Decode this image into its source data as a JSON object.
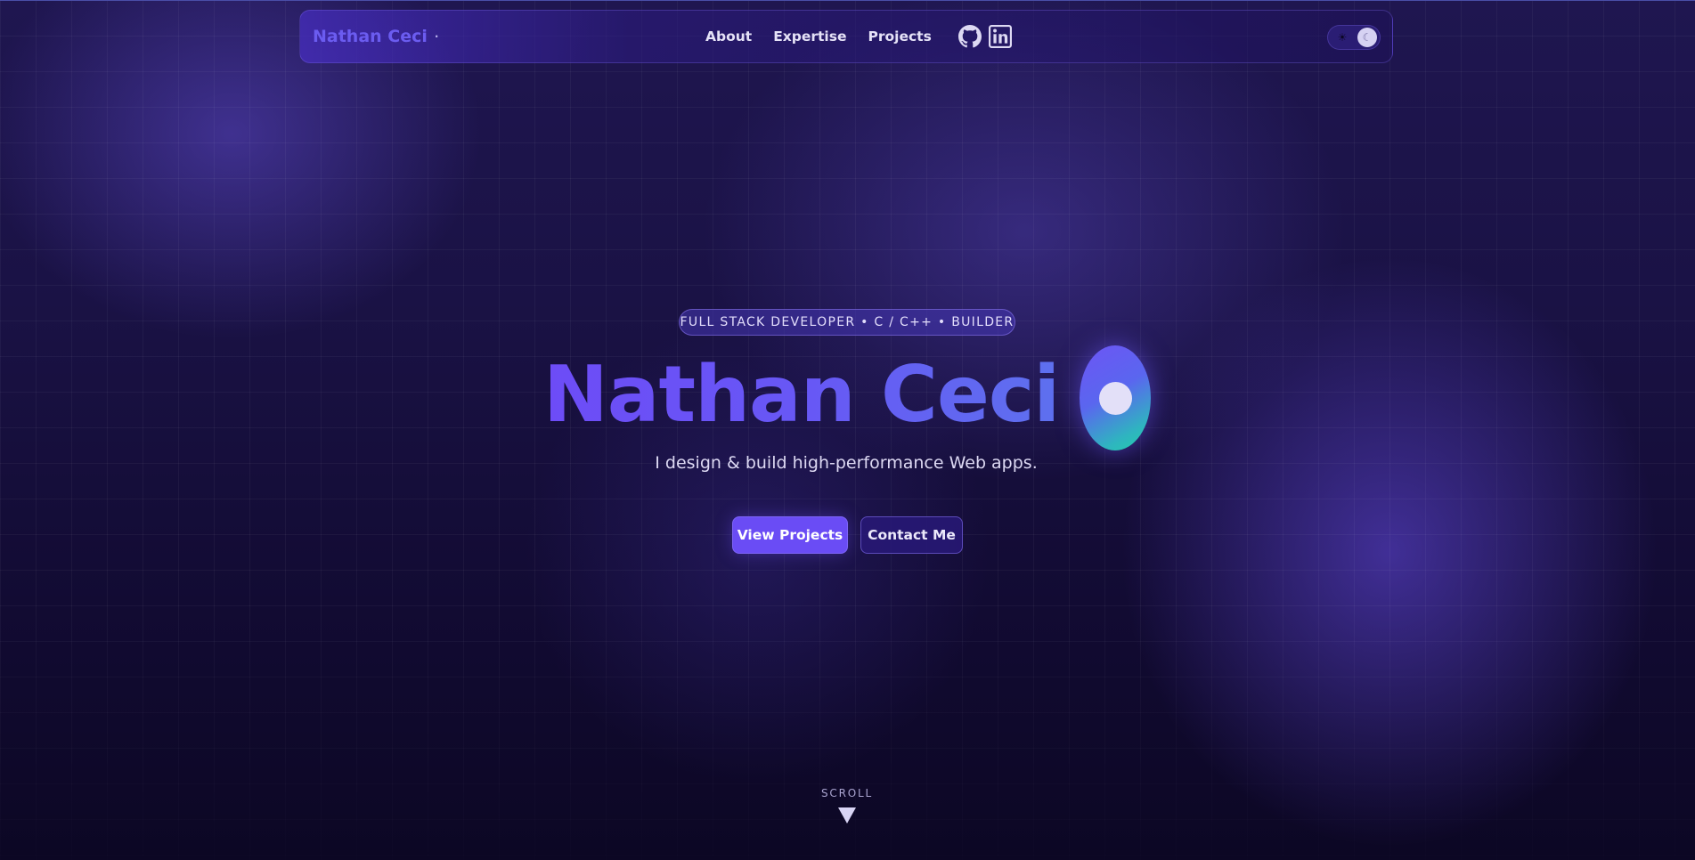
{
  "nav": {
    "brand": "Nathan Ceci",
    "brand_dot": "·",
    "links": [
      "About",
      "Expertise",
      "Projects"
    ],
    "social": [
      {
        "icon": "github-icon"
      },
      {
        "icon": "linkedin-icon"
      }
    ],
    "theme_toggle": {
      "sun_glyph": "☀",
      "moon_glyph": "☾"
    }
  },
  "hero": {
    "tagline": "FULL STACK DEVELOPER • C / C++ • BUILDER",
    "title": "Nathan Ceci",
    "subtitle": "I design & build high-performance Web apps.",
    "primary_button": "View Projects",
    "secondary_button": "Contact Me"
  },
  "scroll": {
    "label": "SCROLL"
  },
  "colors": {
    "accent": "#6a4cf5",
    "background": "#120b30",
    "orb_gradient": [
      "#6d55f5",
      "#22d0a8"
    ]
  }
}
